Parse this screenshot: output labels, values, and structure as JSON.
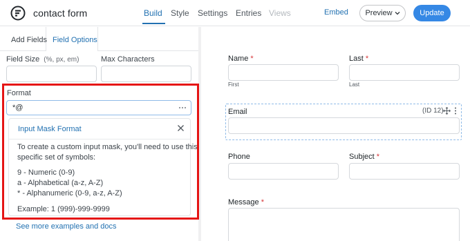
{
  "header": {
    "title": "contact form",
    "nav": [
      {
        "label": "Build",
        "active": true
      },
      {
        "label": "Style"
      },
      {
        "label": "Settings"
      },
      {
        "label": "Entries"
      },
      {
        "label": "Views",
        "disabled": true
      }
    ],
    "embed_label": "Embed",
    "preview_label": "Preview",
    "update_label": "Update"
  },
  "sidebar": {
    "tabs": [
      {
        "label": "Add Fields"
      },
      {
        "label": "Field Options",
        "active": true
      }
    ],
    "field_size_label": "Field Size",
    "field_size_hint": "(%, px, em)",
    "max_chars_label": "Max Characters",
    "format_label": "Format",
    "format_value": "*@",
    "mask_card": {
      "title": "Input Mask Format",
      "intro_line1": "To create a custom input mask, you'll need to use this",
      "intro_line2": "specific set of symbols:",
      "items": [
        "9 - Numeric (0-9)",
        "a - Alphabetical (a-z, A-Z)",
        "* - Alphanumeric (0-9, a-z, A-Z)"
      ],
      "example": "Example: 1 (999)-999-9999"
    },
    "docs_link": "See more examples and docs"
  },
  "form": {
    "name_label": "Name",
    "name_sub_first": "First",
    "last_label": "Last",
    "last_sub": "Last",
    "email_label": "Email",
    "email_id": "(ID 12)",
    "phone_label": "Phone",
    "subject_label": "Subject",
    "message_label": "Message",
    "required_marker": "*"
  },
  "colors": {
    "accent": "#2271b1",
    "update_button": "#3588e5",
    "highlight": "#e51414",
    "required": "#d63638"
  }
}
